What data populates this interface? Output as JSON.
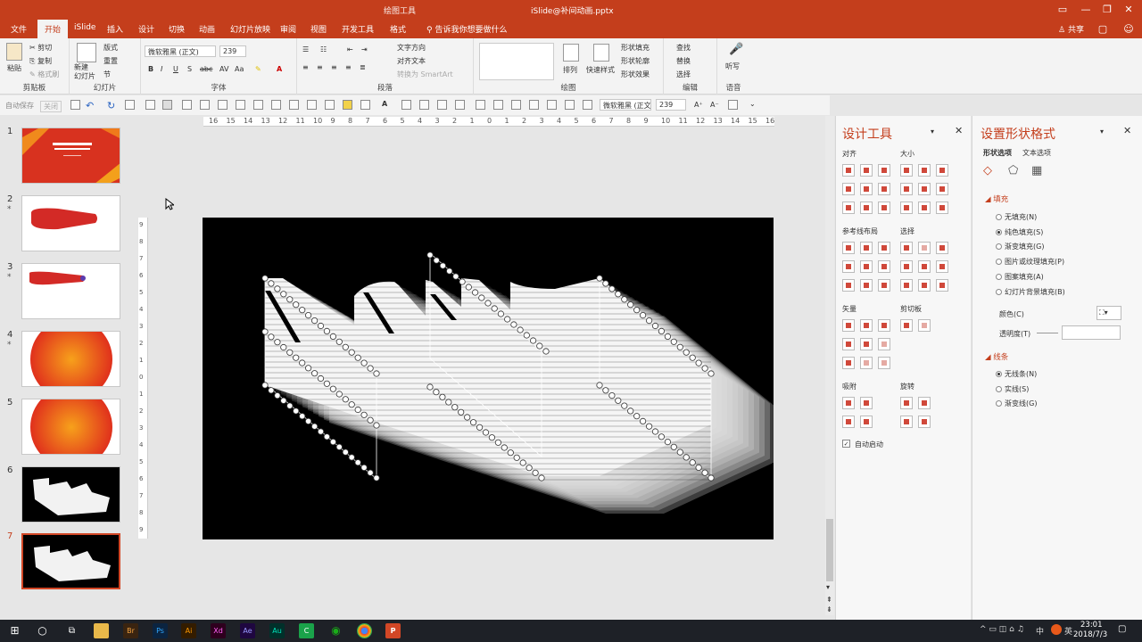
{
  "window": {
    "context_tab": "绘图工具",
    "filename": "iSlide@补间动画.pptx"
  },
  "tabs": [
    "文件",
    "开始",
    "iSlide",
    "插入",
    "设计",
    "切换",
    "动画",
    "幻灯片放映",
    "审阅",
    "视图",
    "开发工具",
    "格式"
  ],
  "tell_me": "告诉我你想要做什么",
  "share": "共享",
  "ribbon": {
    "groups": [
      "剪贴板",
      "幻灯片",
      "字体",
      "段落",
      "绘图",
      "编辑",
      "语音"
    ],
    "paste": "粘贴",
    "cut": "剪切",
    "copy": "复制",
    "format_painter": "格式刷",
    "new_slide": "新建\n幻灯片",
    "layout": "版式",
    "reset": "重置",
    "section": "节",
    "font_name": "微软雅黑 (正文)",
    "font_size": "239",
    "text_direction": "文字方向",
    "align_text": "对齐文本",
    "smartart": "转换为 SmartArt",
    "arrange": "排列",
    "quick_styles": "快速样式",
    "shape_fill": "形状填充",
    "shape_outline": "形状轮廓",
    "shape_effects": "形状效果",
    "find": "查找",
    "replace": "替换",
    "select": "选择",
    "dictate": "听写"
  },
  "qat": {
    "autosave": "自动保存",
    "autosave_state": "关闭",
    "font_name": "微软雅黑 (正文)",
    "font_size": "239"
  },
  "ruler_h": [
    "16",
    "15",
    "14",
    "13",
    "12",
    "11",
    "10",
    "9",
    "8",
    "7",
    "6",
    "5",
    "4",
    "3",
    "2",
    "1",
    "0",
    "1",
    "2",
    "3",
    "4",
    "5",
    "6",
    "7",
    "8",
    "9",
    "10",
    "11",
    "12",
    "13",
    "14",
    "15",
    "16"
  ],
  "ruler_v": [
    "9",
    "8",
    "7",
    "6",
    "5",
    "4",
    "3",
    "2",
    "1",
    "0",
    "1",
    "2",
    "3",
    "4",
    "5",
    "6",
    "7",
    "8",
    "9"
  ],
  "thumbnails": [
    {
      "num": "1",
      "star": ""
    },
    {
      "num": "2",
      "star": "*"
    },
    {
      "num": "3",
      "star": "*"
    },
    {
      "num": "4",
      "star": "*"
    },
    {
      "num": "5",
      "star": ""
    },
    {
      "num": "6",
      "star": ""
    },
    {
      "num": "7",
      "star": ""
    }
  ],
  "design_panel": {
    "title": "设计工具",
    "align": "对齐",
    "size": "大小",
    "guides": "参考线布局",
    "select": "选择",
    "vector": "矢量",
    "clipboard": "剪切板",
    "snap": "吸附",
    "rotate": "旋转",
    "autostart": "自动启动"
  },
  "format_panel": {
    "title": "设置形状格式",
    "tab_shape": "形状选项",
    "tab_text": "文本选项",
    "fill_section": "填充",
    "fill_options": [
      "无填充(N)",
      "纯色填充(S)",
      "渐变填充(G)",
      "图片或纹理填充(P)",
      "图案填充(A)",
      "幻灯片背景填充(B)"
    ],
    "fill_selected": 1,
    "color": "颜色(C)",
    "transparency": "透明度(T)",
    "line_section": "线条",
    "line_options": [
      "无线条(N)",
      "实线(S)",
      "渐变线(G)"
    ],
    "line_selected": 0
  },
  "taskbar": {
    "apps": [
      "Br",
      "Ps",
      "Ai",
      "Xd",
      "Ae",
      "Au"
    ],
    "time": "23:01",
    "date": "2018/7/3",
    "ime": "中",
    "lang": "英"
  },
  "colors": {
    "accent": "#c43e1c",
    "slide_bg": "#000000"
  }
}
